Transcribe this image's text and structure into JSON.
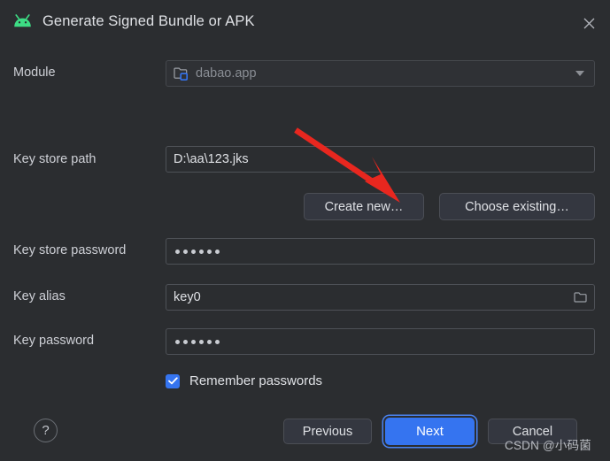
{
  "window": {
    "title": "Generate Signed Bundle or APK",
    "app_icon": "android-robot-icon",
    "close_icon": "close-icon"
  },
  "form": {
    "module": {
      "label": "Module",
      "value": "dabao.app",
      "icon": "module-folder-icon",
      "dropdown_icon": "chevron-down-icon",
      "disabled": true
    },
    "keystore_path": {
      "label": "Key store path",
      "value": "D:\\aa\\123.jks",
      "placeholder": ""
    },
    "create_new_label": "Create new…",
    "choose_existing_label": "Choose existing…",
    "keystore_password": {
      "label": "Key store password",
      "value": "••••••",
      "masked_char_count": 6
    },
    "key_alias": {
      "label": "Key alias",
      "value": "key0",
      "browse_icon": "folder-icon"
    },
    "key_password": {
      "label": "Key password",
      "value": "••••••",
      "masked_char_count": 6
    },
    "remember_passwords": {
      "label": "Remember passwords",
      "checked": true
    }
  },
  "footer": {
    "help_label": "?",
    "previous_label": "Previous",
    "next_label": "Next",
    "cancel_label": "Cancel"
  },
  "annotation": {
    "arrow_color": "#e8271f",
    "target": "create-new-button"
  },
  "watermark": {
    "text": "CSDN @小码菌"
  },
  "colors": {
    "background": "#2b2d30",
    "accent": "#3574f0",
    "android_green": "#3ddc84",
    "text": "#dfe1e5",
    "muted_text": "#8a8e95",
    "border": "#4e5157"
  }
}
